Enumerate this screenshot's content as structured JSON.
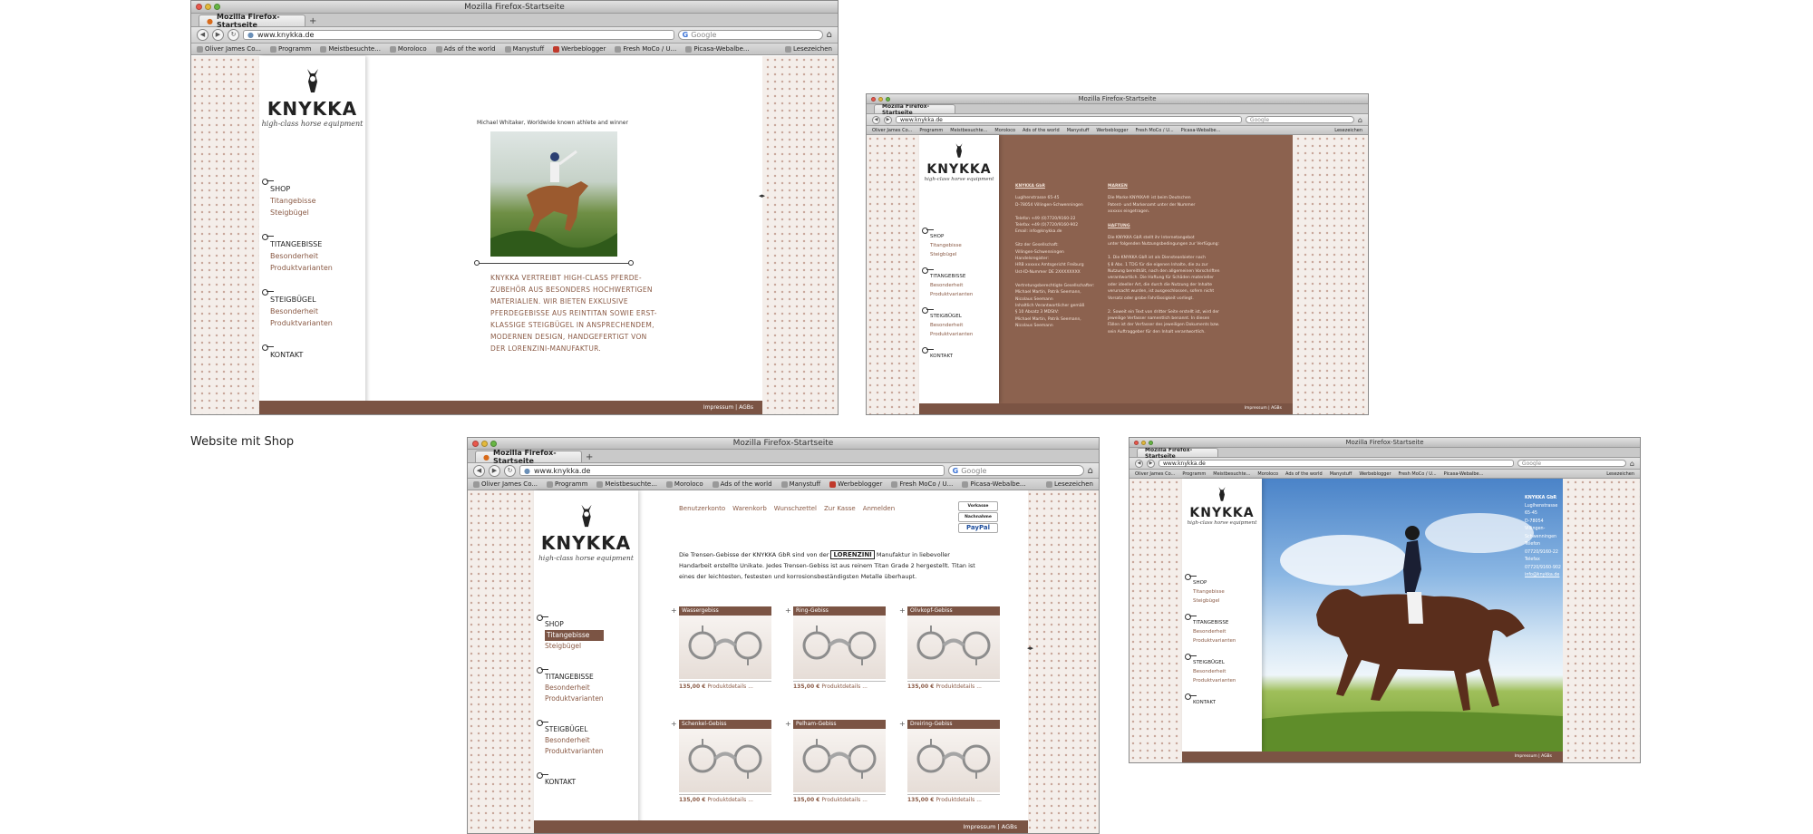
{
  "browser": {
    "window_title": "Mozilla Firefox-Startseite",
    "tab_label": "Mozilla Firefox-Startseite",
    "url": "www.knykka.de",
    "search_placeholder": "Google",
    "bookmarks": [
      "Oliver James Co...",
      "Programm",
      "Meistbesuchte...",
      "Moroloco",
      "Ads of the world",
      "Manystuff",
      "Werbeblogger",
      "Fresh MoCo / U...",
      "Picasa-Webalbe..."
    ],
    "bookmarks_menu": "Lesezeichen"
  },
  "brand": {
    "name": "KNYKKA",
    "tagline": "high-class horse equipment"
  },
  "menu": {
    "shop": "SHOP",
    "shop_items": [
      "Titangebisse",
      "Steigbügel"
    ],
    "titan": "TITANGEBISSE",
    "titan_items": [
      "Besonderheit",
      "Produktvarianten"
    ],
    "steig": "STEIGBÜGEL",
    "steig_items": [
      "Besonderheit",
      "Produktvarianten"
    ],
    "kontakt": "KONTAKT"
  },
  "footer_text": "Impressum | AGBs",
  "section_caption": "Website mit Shop",
  "home_page": {
    "photo_caption": "Michael Whitaker, Worldwide known athlete and winner",
    "intro_lines": [
      "KNYKKA VERTREIBT HIGH-CLASS PFERDE-",
      "ZUBEHÖR AUS BESONDERS HOCHWERTIGEN",
      "MATERIALIEN. WIR BIETEN EXKLUSIVE",
      "PFERDEGEBISSE AUS REINTITAN SOWIE ERST-",
      "KLASSIGE STEIGBÜGEL IN ANSPRECHENDEM,",
      "MODERNEN DESIGN, HANDGEFERTIGT VON",
      "DER LORENZINI-MANUFAKTUR."
    ]
  },
  "impressum_page": {
    "left_heading": "KNYKKA GbR",
    "left_lines": [
      "Luglhenstrasse 65-45",
      "D-78054 Villingen-Schwenningen",
      "",
      "Telefon +49 (0)7720/9160-22",
      "Telefax +49 (0)7720/9160-902",
      "Email: info@knykka.de",
      "",
      "Sitz der Gesellschaft:",
      "Villingen-Schwenningen",
      "Handelsregister:",
      "HRB xxxxxx Amtsgericht Freiburg",
      "Ust-ID-Nummer DE 2XXXXXXXX",
      "",
      "Vertretungsberechtigte Gesellschafter:",
      "Michael Martin, Patrik Seemann,",
      "Nicolaus Seemann",
      "Inhaltlich Verantwortlicher gemäß",
      "§ 10 Absatz 3 MDStV:",
      "Michael Martin, Patrik Seemann,",
      "Nicolaus Seemann"
    ],
    "right_heading_1": "MARKEN",
    "right_lines_1": [
      "Die Marke KNYKKA® ist beim Deutschen",
      "Patent- und Markenamt unter der Nummer",
      "xxxxxx eingetragen."
    ],
    "right_heading_2": "HAFTUNG",
    "right_lines_2": [
      "Die KNYKKA GbR stellt ihr Internetangebot",
      "unter folgenden Nutzungsbedingungen zur Verfügung:",
      "",
      "1. Die KNYKKA GbR ist als Diensteanbieter nach",
      "§ 8 Abs. 1 TDG für die eigenen Inhalte, die zu zur",
      "Nutzung bereithält, nach den allgemeinen Vorschriften",
      "verantwortlich. Die Haftung für Schäden materieller",
      "oder ideeller Art, die durch die Nutzung der Inhalte",
      "verursacht wurden, ist ausgeschlossen, sofern nicht",
      "Vorsatz oder grobe Fahrlässigkeit vorliegt.",
      "",
      "2. Soweit ein Text von dritter Seite erstellt ist, wird der",
      "jeweilige Verfasser namentlich benannt. In diesen",
      "Fällen ist der Verfasser des jeweiligen Dokuments bzw.",
      "sein Auftraggeber für den Inhalt verantwortlich."
    ]
  },
  "shop_page": {
    "header_links": [
      "Benutzerkonto",
      "Warenkorb",
      "Wunschzettel",
      "Zur Kasse",
      "Anmelden"
    ],
    "badges": [
      "Vorkasse",
      "Nachnahme",
      "PayPal"
    ],
    "lorenzini_logo": "LORENZINI",
    "intro_before_logo": "Die Trensen-Gebisse der KNYKKA GbR sind von der",
    "intro_after_logo": "Manufaktur in liebevoller",
    "intro_lines": [
      "Handarbeit erstellte Unikate. Jedes Trensen-Gebiss ist aus reinem Titan Grade 2 hergestellt. Titan ist",
      "eines der leichtesten, festesten und korrosionsbeständigsten Metalle überhaupt."
    ],
    "products": [
      {
        "name": "Wassergebiss",
        "price": "135,00 €",
        "details": "Produktdetails ..."
      },
      {
        "name": "Ring-Gebiss",
        "price": "135,00 €",
        "details": "Produktdetails ..."
      },
      {
        "name": "Olivkopf-Gebiss",
        "price": "135,00 €",
        "details": "Produktdetails ..."
      },
      {
        "name": "Schenkel-Gebiss",
        "price": "135,00 €",
        "details": "Produktdetails ..."
      },
      {
        "name": "Pelham-Gebiss",
        "price": "135,00 €",
        "details": "Produktdetails ..."
      },
      {
        "name": "Dreiring-Gebiss",
        "price": "135,00 €",
        "details": "Produktdetails ..."
      }
    ]
  },
  "contact_page": {
    "lines": [
      "KNYKKA GbR",
      "Luglhenstrasse 65-45",
      "D-78054 Villingen-Schwenningen",
      "Telefon 07720/9160-22",
      "Telefax 07720/9160-902",
      "info@knykka.de"
    ]
  },
  "colors": {
    "brand_brown": "#7b5444",
    "panel_brown": "#8c624f",
    "link_brown": "#8a5a45",
    "pattern_bg": "#f4eeea"
  }
}
